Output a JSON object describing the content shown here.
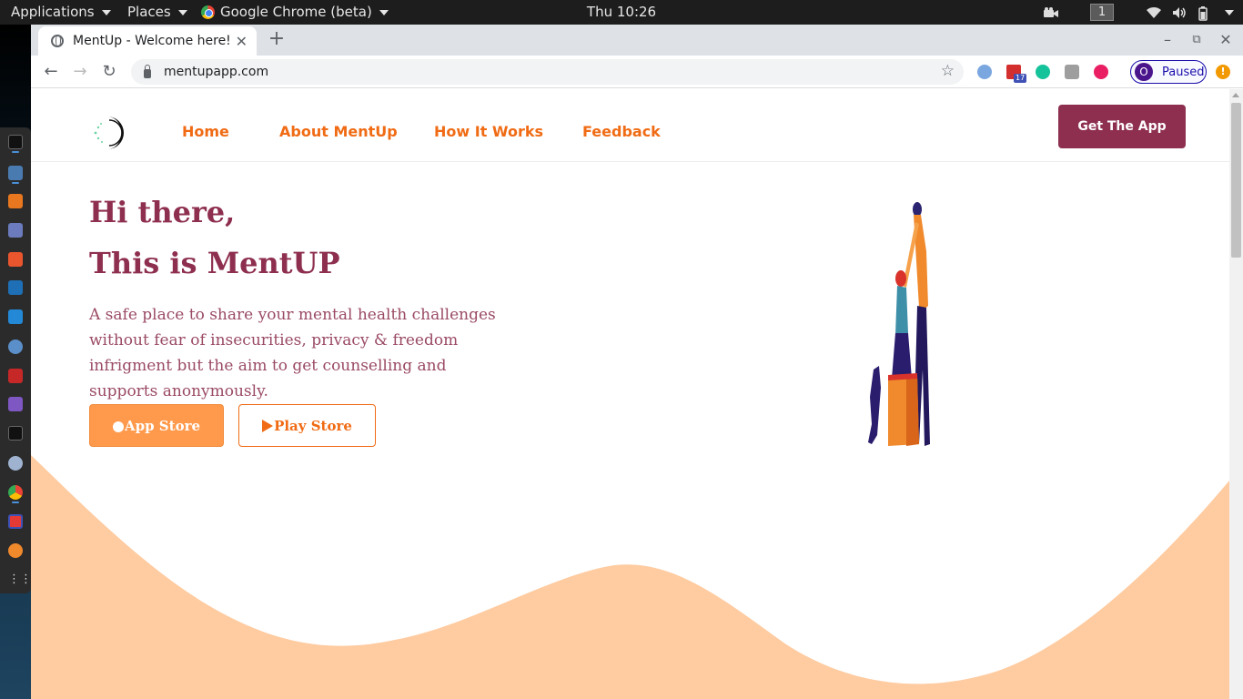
{
  "system_bar": {
    "applications": "Applications",
    "places": "Places",
    "active_app": "Google Chrome (beta)",
    "clock": "Thu 10:26",
    "workspace": "1"
  },
  "browser": {
    "tab_title": "MentUp - Welcome here!",
    "url": "mentupapp.com",
    "profile_initial": "O",
    "profile_status": "Paused",
    "extension_badge": "17",
    "update_glyph": "!"
  },
  "site": {
    "nav": {
      "home": "Home",
      "about": "About MentUp",
      "how": "How It Works",
      "feedback": "Feedback",
      "cta": "Get The App"
    },
    "hero": {
      "line1": "Hi there,",
      "line2": "This is MentUP",
      "description": "A safe place to share your mental health challenges without fear of insecurities, privacy & freedom infrigment but the aim to get counselling and supports anonymously.",
      "app_store": "App Store",
      "play_store": "Play Store"
    },
    "colors": {
      "primary": "#8e2f50",
      "accent": "#f06b14",
      "button_fill": "#ff9a4d",
      "wave": "#ffcba0"
    }
  }
}
